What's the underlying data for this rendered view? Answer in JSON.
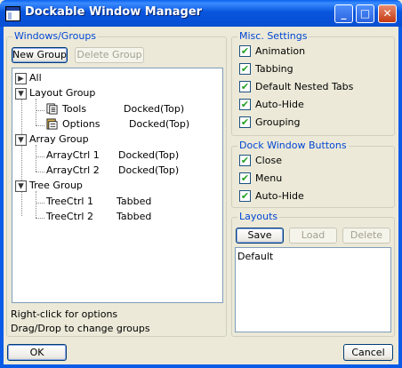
{
  "window": {
    "title": "Dockable Window Manager",
    "buttons": {
      "minimize": "_",
      "maximize": "□",
      "close": "✕"
    }
  },
  "windows_groups": {
    "label": "Windows/Groups",
    "new_group": "New Group",
    "delete_group": "Delete Group",
    "tree": {
      "all": "All",
      "layout_group": "Layout Group",
      "tools": "Tools",
      "tools_state": "Docked(Top)",
      "options": "Options",
      "options_state": "Docked(Top)",
      "array_group": "Array Group",
      "arrayctrl1": "ArrayCtrl 1",
      "arrayctrl1_state": "Docked(Top)",
      "arrayctrl2": "ArrayCtrl 2",
      "arrayctrl2_state": "Docked(Top)",
      "tree_group": "Tree Group",
      "treectrl1": "TreeCtrl 1",
      "treectrl1_state": "Tabbed",
      "treectrl2": "TreeCtrl 2",
      "treectrl2_state": "Tabbed"
    },
    "hint1": "Right-click for options",
    "hint2": "Drag/Drop to change groups"
  },
  "misc_settings": {
    "label": "Misc. Settings",
    "animation": "Animation",
    "tabbing": "Tabbing",
    "default_nested_tabs": "Default Nested Tabs",
    "auto_hide": "Auto-Hide",
    "grouping": "Grouping"
  },
  "dock_window_buttons": {
    "label": "Dock Window Buttons",
    "close": "Close",
    "menu": "Menu",
    "auto_hide": "Auto-Hide"
  },
  "layouts": {
    "label": "Layouts",
    "save": "Save",
    "load": "Load",
    "delete": "Delete",
    "items": [
      "Default"
    ]
  },
  "footer": {
    "ok": "OK",
    "cancel": "Cancel"
  },
  "checkmark": "✔",
  "colors": {
    "title_bar": "#0a5ce6",
    "group_label": "#0046d5",
    "dialog_bg": "#ece9d8"
  }
}
